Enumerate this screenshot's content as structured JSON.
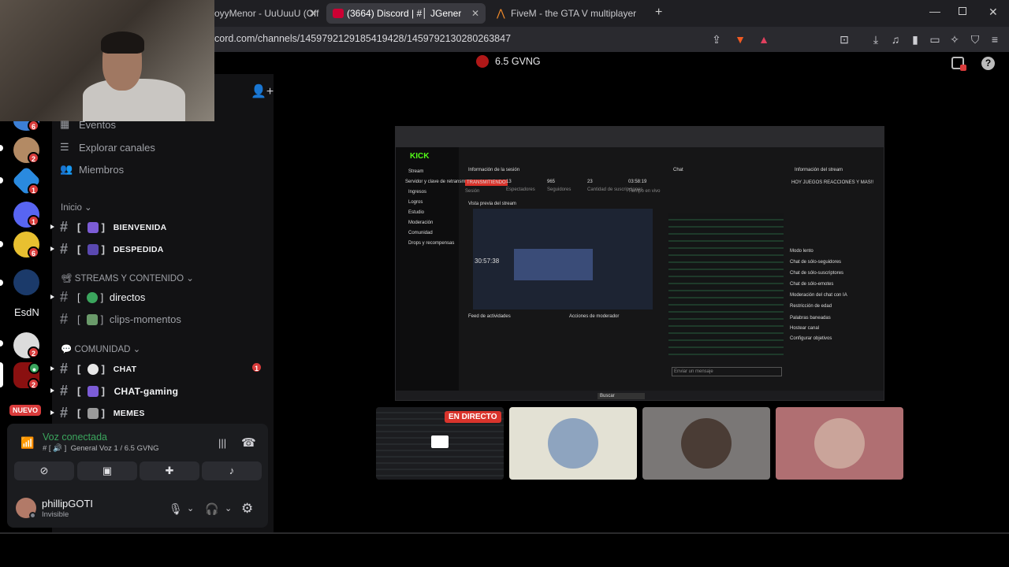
{
  "browser": {
    "tabs": [
      {
        "label": "oyyMenor - UuUuuU (Off"
      },
      {
        "label": "(3664) Discord | #│ JGener"
      },
      {
        "label": "FiveM - the GTA V multiplayer modific"
      }
    ],
    "url": "cord.com/channels/1459792129185419428/1459792130280263847"
  },
  "server": {
    "name": "6.5 GVNG"
  },
  "guilds": {
    "badges": [
      "6",
      "2",
      "1",
      "1",
      "6",
      "2",
      "2"
    ],
    "text_label": "EsdN",
    "new_label": "NUEVO"
  },
  "channels": {
    "nav": {
      "events": "Eventos",
      "browse": "Explorar canales",
      "members": "Miembros"
    },
    "cat_inicio": "Inicio",
    "bienvenida": "BIENVENIDA",
    "despedida": "DESPEDIDA",
    "cat_streams": "STREAMS Y CONTENIDO",
    "directos": "directos",
    "clips": "clips-momentos",
    "cat_comunidad": "COMUNIDAD",
    "chat": "CHAT",
    "chat_badge": "1",
    "chat_gaming": "CHAT-gaming",
    "memes": "MEMES"
  },
  "voice": {
    "status": "Voz conectada",
    "channel": "General Voz 1 / 6.5 GVNG"
  },
  "user": {
    "name": "phillipGOTI",
    "status": "Invisible"
  },
  "stage": {
    "live_label": "EN DIRECTO",
    "stream": {
      "brand": "KICK",
      "sidebar_items": [
        "Stream",
        "Servidor y clave de retransm",
        "Ingresos",
        "Logros",
        "Estudio",
        "Moderación",
        "Comunidad",
        "Drops y recompensas"
      ],
      "session_title": "Información de la sesión",
      "live_tag": "TRANSMITIENDO",
      "stats": [
        "13",
        "965",
        "23",
        "03:58:19"
      ],
      "stat_labels": [
        "Sesión",
        "Espectadores",
        "Seguidores",
        "Cantidad de suscripciones",
        "Tiempo en vivo"
      ],
      "preview_title": "Vista previa del stream",
      "timer": "30:57:38",
      "chat_title": "Chat",
      "chat_placeholder": "Enviar un mensaje",
      "stream_info_title": "Información del stream",
      "stream_info_text": "HOY JUEGOS REACCIONES Y MAS!!",
      "mod_actions": [
        "Modo lento",
        "Chat de sólo-seguidores",
        "Chat de sólo-suscriptores",
        "Chat de sólo-emotes",
        "Moderación del chat con IA",
        "Restricción de edad",
        "Palabras baneadas",
        "Hostear canal",
        "Configurar objetivos"
      ],
      "activity_title": "Feed de actividades",
      "moderator_title": "Acciones de moderador",
      "taskbar_search": "Buscar"
    }
  }
}
